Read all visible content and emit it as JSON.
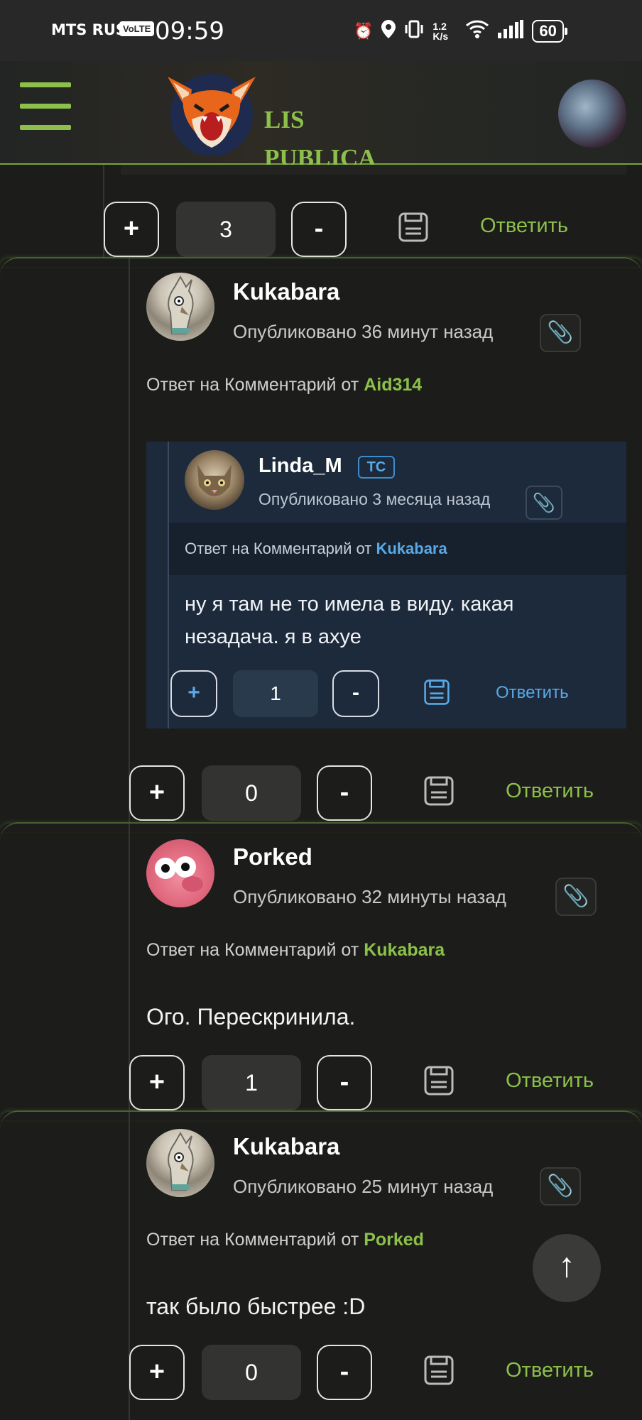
{
  "status_bar": {
    "carrier": "MTS RUS",
    "volte": "VoLTE",
    "time": "09:59",
    "speed": "1.2 K/s",
    "battery": "60"
  },
  "header": {
    "brand_line1": "LIS",
    "brand_line2": "PUBLICA",
    "accent_color": "#8cc04a"
  },
  "top_controls": {
    "plus": "+",
    "score": "3",
    "minus": "-",
    "reply": "Ответить"
  },
  "comments": [
    {
      "author": "Kukabara",
      "posted": "Опубликовано 36 минут назад",
      "reply_prefix": "Ответ на Комментарий от",
      "reply_to": "Aid314",
      "quote": {
        "author": "Linda_M",
        "badge": "TC",
        "posted": "Опубликовано 3 месяца назад",
        "reply_prefix": "Ответ на Комментарий от",
        "reply_to": "Kukabara",
        "body": "ну я там не то имела в виду. какая незадача. я в ахуе",
        "plus": "+",
        "score": "1",
        "minus": "-",
        "reply": "Ответить"
      },
      "plus": "+",
      "score": "0",
      "minus": "-",
      "reply": "Ответить"
    },
    {
      "author": "Porked",
      "posted": "Опубликовано 32 минуты назад",
      "reply_prefix": "Ответ на Комментарий от",
      "reply_to": "Kukabara",
      "body": "Ого. Перескринила.",
      "plus": "+",
      "score": "1",
      "minus": "-",
      "reply": "Ответить"
    },
    {
      "author": "Kukabara",
      "posted": "Опубликовано 25 минут назад",
      "reply_prefix": "Ответ на Комментарий от",
      "reply_to": "Porked",
      "body": "так было быстрее :D",
      "plus": "+",
      "score": "0",
      "minus": "-",
      "reply": "Ответить"
    }
  ],
  "scroll_top": "↑"
}
